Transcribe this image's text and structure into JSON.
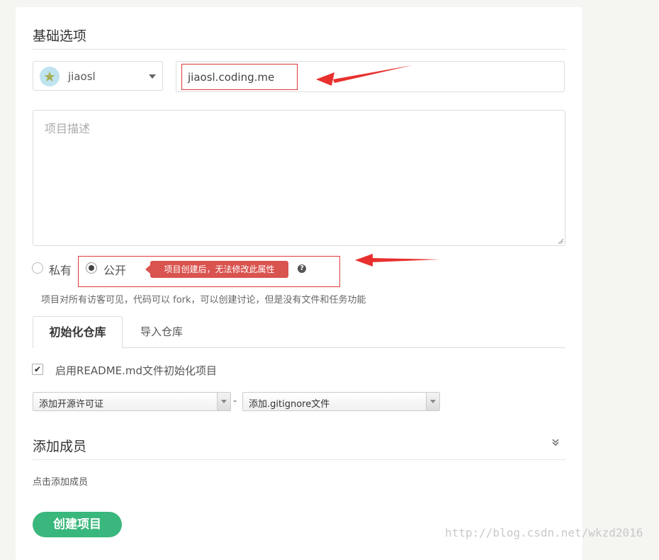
{
  "basic": {
    "title": "基础选项",
    "owner": "jiaosl",
    "project_name": "jiaosl.coding.me",
    "description_placeholder": "项目描述"
  },
  "visibility": {
    "private_label": "私有",
    "public_label": "公开",
    "selected": "公开",
    "tooltip": "项目创建后，无法修改此属性",
    "help_glyph": "?",
    "hint": "项目对所有访客可见，代码可以 fork，可以创建讨论，但是没有文件和任务功能"
  },
  "repo_tabs": {
    "init_label": "初始化仓库",
    "import_label": "导入仓库",
    "active": "初始化仓库"
  },
  "init_options": {
    "readme_checked": true,
    "check_glyph": "✔",
    "readme_label": "启用README.md文件初始化项目",
    "license_select": "添加开源许可证",
    "separator": "-",
    "gitignore_select": "添加.gitignore文件"
  },
  "members": {
    "title": "添加成员",
    "collapse_glyph": "⌄⌄",
    "hint": "点击添加成员"
  },
  "submit": {
    "label": "创建项目"
  },
  "watermark": "http://blog.csdn.net/wkzd2016",
  "colors": {
    "accent": "#3ab77c",
    "annotation_red": "#e03a3a",
    "tooltip_bg": "#d9534f"
  },
  "icons": [
    "avatar-star-icon",
    "chevron-down-icon",
    "question-icon",
    "checkmark-icon",
    "double-chevron-down-icon"
  ]
}
